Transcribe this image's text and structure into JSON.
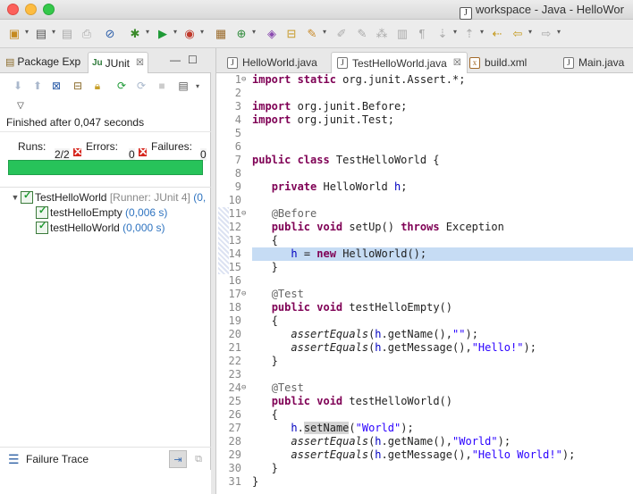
{
  "window": {
    "title": "workspace - Java - HelloWor",
    "icon": "java-file-icon"
  },
  "toolbar": {
    "icons": [
      "new-icon",
      "save-icon",
      "save-all-icon",
      "print-icon",
      "skip-breakpoints-icon",
      "debug-icon",
      "run-icon",
      "external-tools-icon",
      "new-java-project-icon",
      "new-class-icon",
      "open-type-icon",
      "open-task-icon",
      "search-icon",
      "toggle-mark-occurrences-icon",
      "annotation-icon",
      "block-select-icon",
      "whitespace-icon",
      "next-annotation-icon",
      "prev-annotation-icon",
      "last-edit-icon",
      "back-icon",
      "forward-icon"
    ]
  },
  "left": {
    "tabs": [
      {
        "label": "Package Exp",
        "icon": "package-explorer-icon"
      },
      {
        "label": "JUnit",
        "icon": "junit-icon"
      }
    ],
    "tab_close": "☒",
    "finished_text": "Finished after 0,047 seconds",
    "runs_label": "Runs:",
    "runs_value": "2/2",
    "errors_label": "Errors:",
    "errors_value": "0",
    "failures_label": "Failures:",
    "failures_value": "0",
    "progress": 1.0,
    "progress_color": "#27c35a",
    "tree": {
      "root": {
        "name": "TestHelloWorld",
        "runner": "[Runner: JUnit 4]",
        "time": "(0,"
      },
      "children": [
        {
          "name": "testHelloEmpty",
          "time": "(0,006 s)"
        },
        {
          "name": "testHelloWorld",
          "time": "(0,000 s)"
        }
      ]
    },
    "failure_trace_label": "Failure Trace"
  },
  "editor": {
    "tabs": [
      {
        "label": "HelloWorld.java",
        "icon": "java-file-icon",
        "active": false
      },
      {
        "label": "TestHelloWorld.java",
        "icon": "java-file-icon",
        "active": true
      },
      {
        "label": "build.xml",
        "icon": "xml-file-icon",
        "active": false
      },
      {
        "label": "Main.java",
        "icon": "java-file-icon",
        "active": false
      }
    ],
    "tab_close": "☒",
    "lines": [
      {
        "n": "1",
        "fold": "⊖",
        "html": "<span class='kw'>import static</span> org.junit.Assert.*;"
      },
      {
        "n": "2",
        "html": ""
      },
      {
        "n": "3",
        "html": "<span class='kw'>import</span> org.junit.Before;"
      },
      {
        "n": "4",
        "html": "<span class='kw'>import</span> org.junit.Test;"
      },
      {
        "n": "5",
        "html": ""
      },
      {
        "n": "6",
        "html": ""
      },
      {
        "n": "7",
        "html": "<span class='kw'>public class</span> TestHelloWorld {"
      },
      {
        "n": "8",
        "html": ""
      },
      {
        "n": "9",
        "html": "   <span class='kw'>private</span> HelloWorld <span class='fld'>h</span>;"
      },
      {
        "n": "10",
        "html": ""
      },
      {
        "n": "11",
        "fold": "⊖",
        "html": "   <span class='ann'>@Before</span>"
      },
      {
        "n": "12",
        "html": "   <span class='kw'>public void</span> setUp() <span class='kw'>throws</span> Exception"
      },
      {
        "n": "13",
        "html": "   {"
      },
      {
        "n": "14",
        "hl": true,
        "html": "      <span class='fld'>h</span> = <span class='kw'>new</span> HelloWorld();"
      },
      {
        "n": "15",
        "html": "   }"
      },
      {
        "n": "16",
        "html": ""
      },
      {
        "n": "17",
        "fold": "⊖",
        "html": "   <span class='ann'>@Test</span>"
      },
      {
        "n": "18",
        "html": "   <span class='kw'>public void</span> testHelloEmpty()"
      },
      {
        "n": "19",
        "html": "   {"
      },
      {
        "n": "20",
        "html": "      <span class='mth'>assertEquals</span>(<span class='fld'>h</span>.getName(),<span class='str'>\"\"</span>);"
      },
      {
        "n": "21",
        "html": "      <span class='mth'>assertEquals</span>(<span class='fld'>h</span>.getMessage(),<span class='str'>\"Hello!\"</span>);"
      },
      {
        "n": "22",
        "html": "   }"
      },
      {
        "n": "23",
        "html": ""
      },
      {
        "n": "24",
        "fold": "⊖",
        "html": "   <span class='ann'>@Test</span>"
      },
      {
        "n": "25",
        "html": "   <span class='kw'>public void</span> testHelloWorld()"
      },
      {
        "n": "26",
        "html": "   {"
      },
      {
        "n": "27",
        "html": "      <span class='fld'>h</span>.<span class='occ'>setName</span>(<span class='str'>\"World\"</span>);"
      },
      {
        "n": "28",
        "html": "      <span class='mth'>assertEquals</span>(<span class='fld'>h</span>.getName(),<span class='str'>\"World\"</span>);"
      },
      {
        "n": "29",
        "html": "      <span class='mth'>assertEquals</span>(<span class='fld'>h</span>.getMessage(),<span class='str'>\"Hello World!\"</span>);"
      },
      {
        "n": "30",
        "html": "   }"
      },
      {
        "n": "31",
        "html": "}"
      }
    ]
  }
}
